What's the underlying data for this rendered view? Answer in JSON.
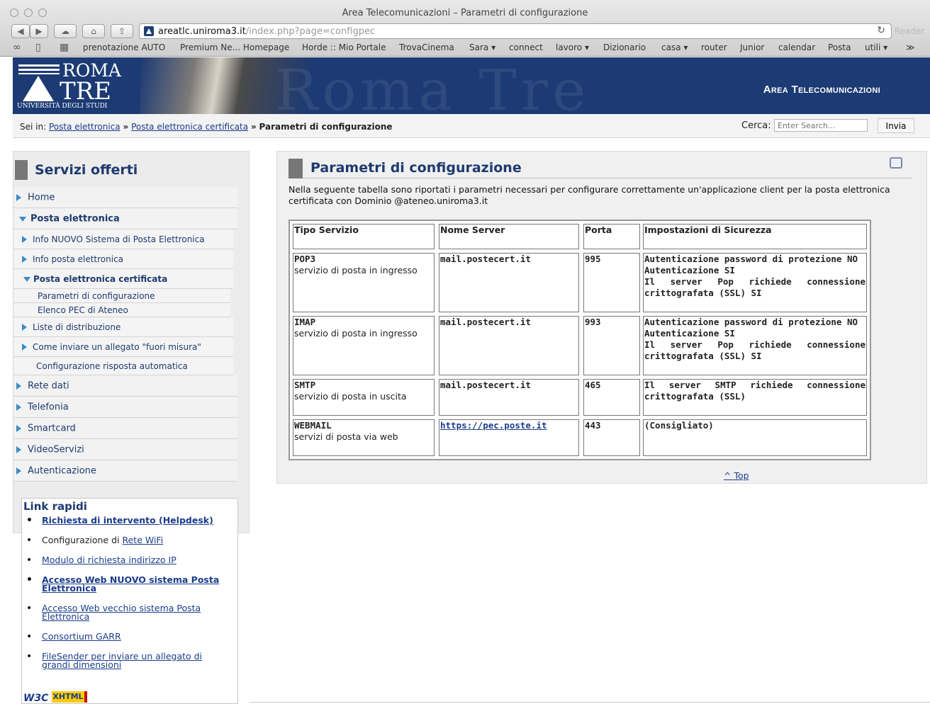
{
  "browser": {
    "window_title": "Area Telecomunicazioni – Parametri di configurazione",
    "url_host": "areatlc.uniroma3.it",
    "url_path": "/index.php?page=configpec",
    "reader_label": "Reader",
    "bookmarks": [
      "prenotazione AUTO",
      "Premium Ne... Homepage",
      "Horde :: Mio Portale",
      "TrovaCinema",
      "Sara ▾",
      "connect",
      "lavoro ▾",
      "Dizionario",
      "casa ▾",
      "router",
      "Junior",
      "calendar",
      "Posta",
      "utili ▾",
      "≫"
    ]
  },
  "banner": {
    "logo_roma": "ROMA",
    "logo_tre": "TRE",
    "logo_univ": "UNIVERSITÀ DEGLI STUDI",
    "watermark": "Roma Tre",
    "area_title": "Area Telecomunicazioni"
  },
  "breadcrumb": {
    "prefix": "Sei in:",
    "items": [
      "Posta elettronica",
      "Posta elettronica certificata"
    ],
    "separator": "»",
    "current": "Parametri di configurazione"
  },
  "search": {
    "label": "Cerca:",
    "placeholder": "Enter Search...",
    "button": "Invia"
  },
  "sidebar": {
    "title": "Servizi offerti",
    "items": [
      "Home",
      "Posta elettronica",
      "Info NUOVO Sistema di Posta Elettronica",
      "Info posta elettronica",
      "Posta elettronica certificata",
      "Parametri di configurazione",
      "Elenco PEC di Ateneo",
      "Liste di distribuzione",
      "Come inviare un allegato \"fuori misura\"",
      "Configurazione risposta automatica",
      "Rete dati",
      "Telefonia",
      "Smartcard",
      "VideoServizi",
      "Autenticazione"
    ]
  },
  "quick_links": {
    "title": "Link rapidi",
    "items": [
      {
        "text": "Richiesta di intervento (Helpdesk)"
      },
      {
        "prefix": "Configurazione di ",
        "text": "Rete WiFi"
      },
      {
        "text": "Modulo di richiesta indirizzo IP"
      },
      {
        "text": "Accesso Web NUOVO sistema Posta Elettronica"
      },
      {
        "text": "Accesso Web vecchio sistema Posta Elettronica"
      },
      {
        "text": "Consortium GARR"
      },
      {
        "text": "FileSender per inviare un allegato di grandi dimensioni"
      }
    ],
    "badge_w3c": "W3C",
    "badge_xhtml": "XHTML"
  },
  "content": {
    "title": "Parametri di configurazione",
    "intro": "Nella seguente tabella sono riportati i parametri necessari per configurare correttamente un'applicazione client per la posta elettronica certificata con Dominio @ateneo.uniroma3.it",
    "table": {
      "headers": [
        "Tipo Servizio",
        "Nome Server",
        "Porta",
        "Impostazioni di Sicurezza"
      ],
      "rows": [
        {
          "type": "POP3",
          "desc": "servizio di posta in ingresso",
          "server": "mail.postecert.it",
          "port": "995",
          "sec1": "Autenticazione password di protezione NO",
          "sec2": "Autenticazione SI",
          "sec3": "Il server Pop richiede connessione crittografata (SSL) SI"
        },
        {
          "type": "IMAP",
          "desc": "servizio di posta in ingresso",
          "server": "mail.postecert.it",
          "port": "993",
          "sec1": "Autenticazione password di protezione NO",
          "sec2": "Autenticazione SI",
          "sec3": "Il server Pop richiede connessione crittografata (SSL) SI"
        },
        {
          "type": "SMTP",
          "desc": "servizio di posta in uscita",
          "server": "mail.postecert.it",
          "port": "465",
          "sec3": "Il server SMTP richiede connessione crittografata (SSL)"
        },
        {
          "type": "WEBMAIL",
          "desc": "servizi di posta via web",
          "server": "https://pec.poste.it",
          "port": "443",
          "sec3": "(Consigliato)"
        }
      ]
    },
    "top_link": "^ Top"
  }
}
